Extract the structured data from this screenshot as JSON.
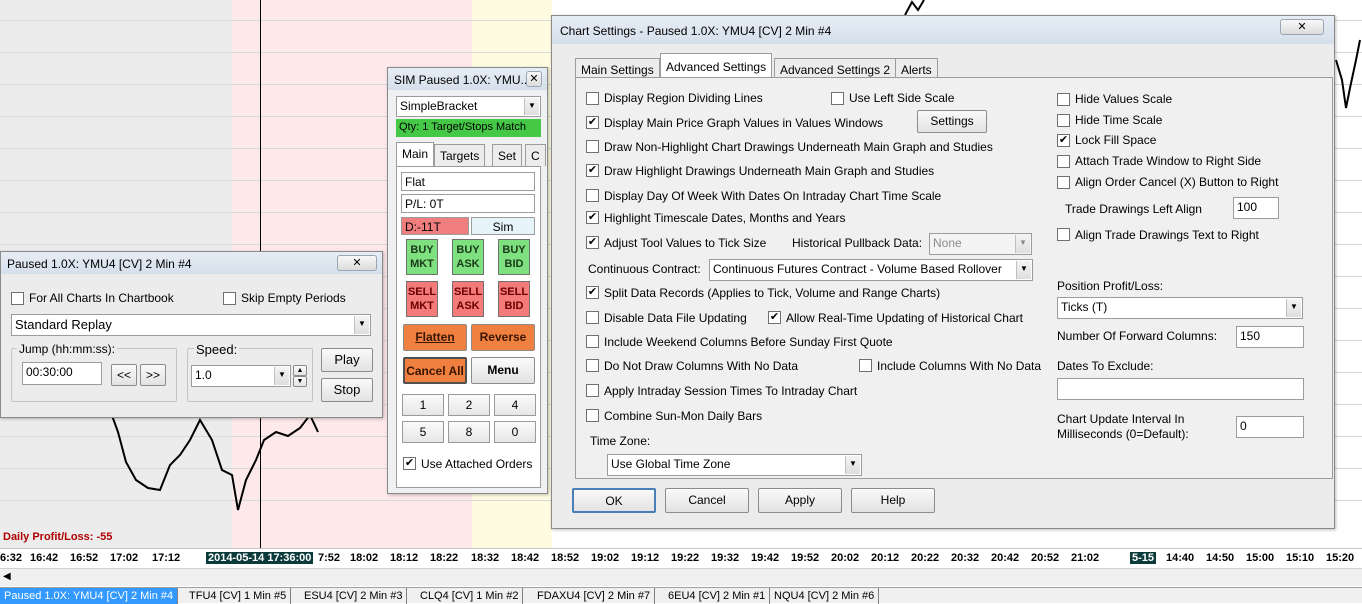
{
  "chart": {
    "daily_pl": "Daily Profit/Loss: -55",
    "time_labels": [
      "6:32",
      "16:42",
      "16:52",
      "17:02",
      "17:12",
      "",
      "2014-05-14  17:36:00",
      "7:52",
      "18:02",
      "18:12",
      "18:22",
      "18:32",
      "18:42",
      "18:52",
      "19:02",
      "19:12",
      "19:22",
      "19:32",
      "19:42",
      "19:52",
      "20:02",
      "20:12",
      "20:22",
      "20:32",
      "20:42",
      "20:52",
      "21:02",
      "5-15",
      "14:40",
      "14:50",
      "15:00",
      "15:10",
      "15:20"
    ],
    "tabs": [
      "Paused 1.0X: YMU4 [CV]  2 Min  #4",
      "TFU4 [CV]  1 Min  #5",
      "ESU4 [CV]  2 Min  #3",
      "CLQ4 [CV]  1 Min  #2",
      "FDAXU4 [CV]  2 Min  #7",
      "6EU4 [CV]  2 Min  #1",
      "NQU4 [CV]  2 Min  #6"
    ]
  },
  "replay": {
    "title": "Paused 1.0X: YMU4 [CV]  2 Min   #4",
    "close": "✕",
    "for_all_charts": "For All Charts In Chartbook",
    "skip_empty": "Skip Empty Periods",
    "mode": "Standard Replay",
    "jump_label": "Jump (hh:mm:ss):",
    "jump_value": "00:30:00",
    "back": "<<",
    "forward": ">>",
    "speed_label": "Speed:",
    "speed_value": "1.0",
    "play": "Play",
    "stop": "Stop"
  },
  "trade": {
    "title": "SIM Paused 1.0X: YMU...",
    "close": "✕",
    "bracket": "SimpleBracket",
    "qty": "Qty: 1 Target/Stops Match",
    "tabs": [
      "Main",
      "Targets",
      "Set",
      "C"
    ],
    "position": "Flat",
    "pl": "P/L: 0T",
    "daily": "D:-11T",
    "mode": "Sim",
    "buy_mkt": [
      "BUY",
      "MKT"
    ],
    "buy_ask": [
      "BUY",
      "ASK"
    ],
    "buy_bid": [
      "BUY",
      "BID"
    ],
    "sell_mkt": [
      "SELL",
      "MKT"
    ],
    "sell_ask": [
      "SELL",
      "ASK"
    ],
    "sell_bid": [
      "SELL",
      "BID"
    ],
    "flatten": "Flatten",
    "reverse": "Reverse",
    "cancel_all": "Cancel All",
    "menu": "Menu",
    "qty_buttons": [
      "1",
      "2",
      "4",
      "5",
      "8",
      "0"
    ],
    "use_attached": "Use Attached Orders"
  },
  "settings": {
    "title": "Chart Settings - Paused 1.0X: YMU4 [CV]  2 Min   #4",
    "close": "✕",
    "tabs": [
      "Main Settings",
      "Advanced Settings",
      "Advanced Settings 2",
      "Alerts"
    ],
    "left": {
      "display_region": "Display Region Dividing Lines",
      "use_left_scale": "Use Left Side Scale",
      "display_main_values": "Display Main Price Graph Values in Values Windows",
      "settings_btn": "Settings",
      "draw_nonhighlight": "Draw Non-Highlight Chart Drawings Underneath Main Graph and Studies",
      "draw_highlight": "Draw Highlight Drawings Underneath Main Graph and Studies",
      "display_dow": "Display Day Of Week With Dates On Intraday Chart Time Scale",
      "highlight_timescale": "Highlight Timescale Dates, Months and Years",
      "adjust_tool": "Adjust Tool Values to Tick Size",
      "hist_pullback_label": "Historical Pullback Data:",
      "hist_pullback_value": "None",
      "continuous_label": "Continuous Contract:",
      "continuous_value": "Continuous Futures Contract - Volume Based Rollover",
      "split_data": "Split Data Records (Applies to Tick, Volume and Range Charts)",
      "disable_updating": "Disable Data File Updating",
      "allow_realtime": "Allow Real-Time Updating of Historical Chart",
      "include_weekend": "Include Weekend Columns Before Sunday First Quote",
      "no_draw_columns": "Do Not Draw Columns With No Data",
      "include_columns": "Include Columns With No Data",
      "apply_intraday": "Apply Intraday Session Times To Intraday Chart",
      "combine_sunmon": "Combine Sun-Mon Daily Bars",
      "timezone_label": "Time Zone:",
      "timezone_value": "Use Global Time Zone"
    },
    "right": {
      "hide_values": "Hide Values Scale",
      "hide_time": "Hide Time Scale",
      "lock_fill": "Lock Fill Space",
      "attach_trade": "Attach Trade Window to Right Side",
      "align_cancel": "Align Order Cancel (X) Button to Right",
      "trade_drawings_label": "Trade Drawings Left Align",
      "trade_drawings_value": "100",
      "align_trade_text": "Align Trade Drawings Text to Right",
      "position_pl_label": "Position Profit/Loss:",
      "position_pl_value": "Ticks (T)",
      "forward_cols_label": "Number Of Forward Columns:",
      "forward_cols_value": "150",
      "dates_exclude_label": "Dates To Exclude:",
      "dates_exclude_value": "",
      "update_interval_label1": "Chart Update Interval In",
      "update_interval_label2": "Milliseconds (0=Default):",
      "update_interval_value": "0"
    },
    "buttons": {
      "ok": "OK",
      "cancel": "Cancel",
      "apply": "Apply",
      "help": "Help"
    }
  }
}
